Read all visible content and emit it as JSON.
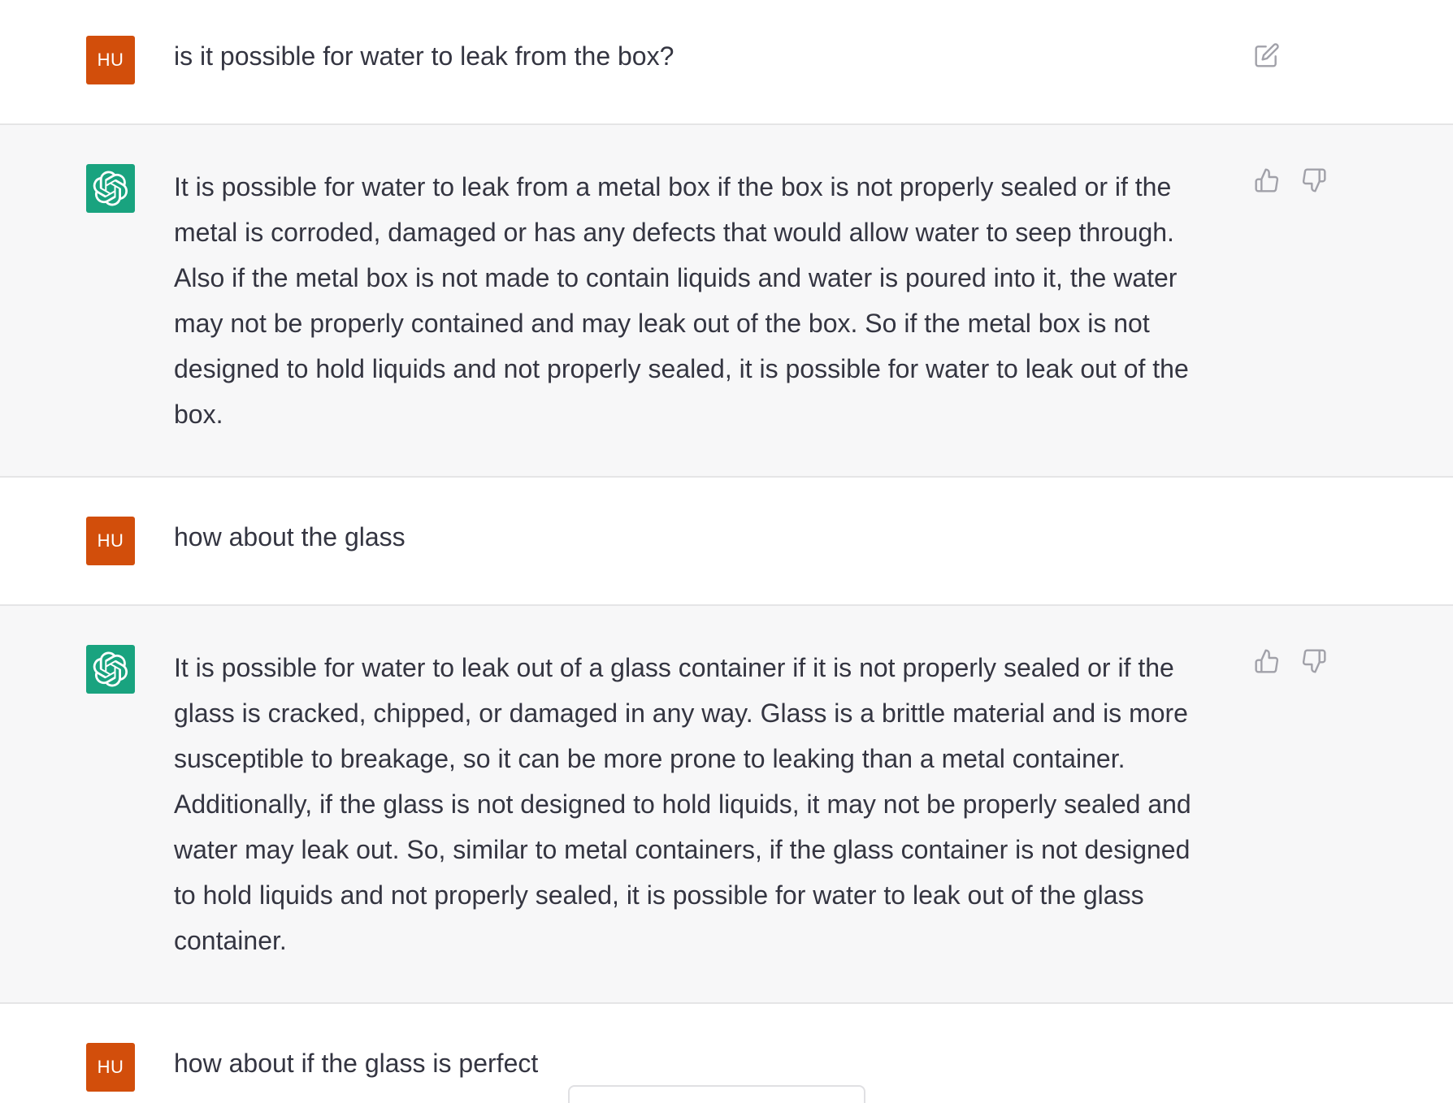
{
  "conversation": {
    "messages": [
      {
        "role": "user",
        "avatar_label": "HU",
        "text": "is it possible for water to leak from the box?",
        "action_icon": "edit-icon"
      },
      {
        "role": "assistant",
        "avatar_icon": "openai-logo-icon",
        "lines": [
          "It is possible for water to leak from a metal box if the box is not properly sealed or if the",
          "metal is corroded, damaged or has any defects that would allow water to seep through.",
          "Also if the metal box is not made to contain liquids and water is poured into it, the water",
          "may not be properly contained and may leak out of the box. So if the metal box is not",
          "designed to hold liquids and not properly sealed, it is possible for water to leak out of the",
          "box."
        ],
        "action_icons": [
          "thumbs-up-icon",
          "thumbs-down-icon"
        ]
      },
      {
        "role": "user",
        "avatar_label": "HU",
        "text": "how about the glass"
      },
      {
        "role": "assistant",
        "avatar_icon": "openai-logo-icon",
        "lines": [
          "It is possible for water to leak out of a glass container if it is not properly sealed or if the",
          "glass is cracked, chipped, or damaged in any way. Glass is a brittle material and is more",
          "susceptible to breakage, so it can be more prone to leaking than a metal container.",
          "Additionally, if the glass is not designed to hold liquids, it may not be properly sealed and",
          "water may leak out. So, similar to metal containers, if the glass container is not designed",
          "to hold liquids and not properly sealed, it is possible for water to leak out of the glass",
          "container."
        ],
        "action_icons": [
          "thumbs-up-icon",
          "thumbs-down-icon"
        ]
      },
      {
        "role": "user",
        "avatar_label": "HU",
        "text": "how about if the glass is perfect"
      }
    ]
  },
  "colors": {
    "user_bg": "#ffffff",
    "assistant_bg": "#f7f7f8",
    "user_avatar": "#d24e0b",
    "assistant_avatar": "#19a37f",
    "text": "#343541",
    "icon": "#a1a1a9",
    "divider": "#e5e5e6"
  }
}
